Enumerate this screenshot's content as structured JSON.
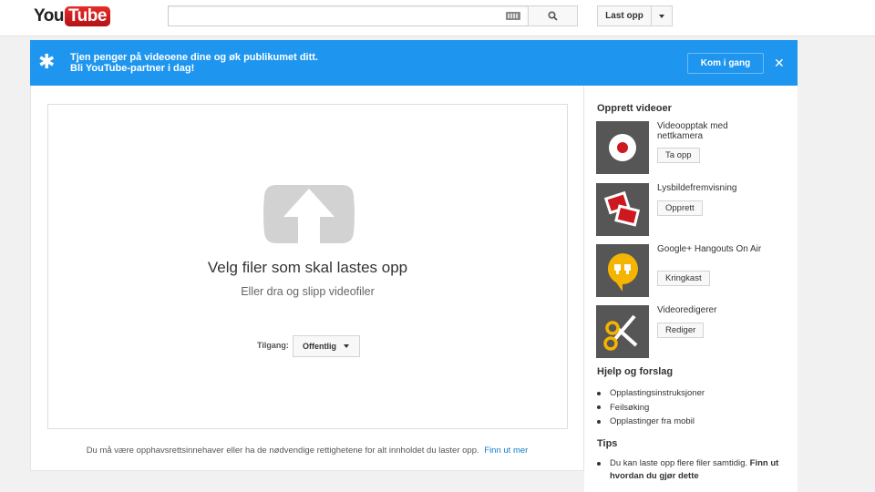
{
  "header": {
    "logo_you": "You",
    "logo_tube": "Tube",
    "search_placeholder": "",
    "upload_label": "Last opp"
  },
  "banner": {
    "line1": "Tjen penger på videoene dine og øk publikumet ditt.",
    "line2": "Bli YouTube-partner i dag!",
    "cta": "Kom i gang",
    "star": "✱",
    "close": "✕",
    "color": "#1e96f0"
  },
  "upload": {
    "title": "Velg filer som skal lastes opp",
    "subtitle": "Eller dra og slipp videofiler",
    "access_label": "Tilgang:",
    "access_value": "Offentlig",
    "copyright_text": "Du må være opphavsrettsinnehaver eller ha de nødvendige rettighetene for alt innholdet du laster opp.",
    "copyright_link": "Finn ut mer"
  },
  "sidebar": {
    "create_heading": "Opprett videoer",
    "tools": [
      {
        "label": "Videoopptak med nettkamera",
        "button": "Ta opp",
        "icon": "webcam-record-icon"
      },
      {
        "label": "Lysbildefremvisning",
        "button": "Opprett",
        "icon": "slideshow-icon"
      },
      {
        "label": "Google+ Hangouts On Air",
        "button": "Kringkast",
        "icon": "hangouts-icon"
      },
      {
        "label": "Videoredigerer",
        "button": "Rediger",
        "icon": "scissors-icon"
      }
    ],
    "help_heading": "Hjelp og forslag",
    "help_items": [
      "Opplastingsinstruksjoner",
      "Feilsøking",
      "Opplastinger fra mobil"
    ],
    "tips_heading": "Tips",
    "tip_text": "Du kan laste opp flere filer samtidig.",
    "tip_link": "Finn ut hvordan du gjør dette"
  }
}
